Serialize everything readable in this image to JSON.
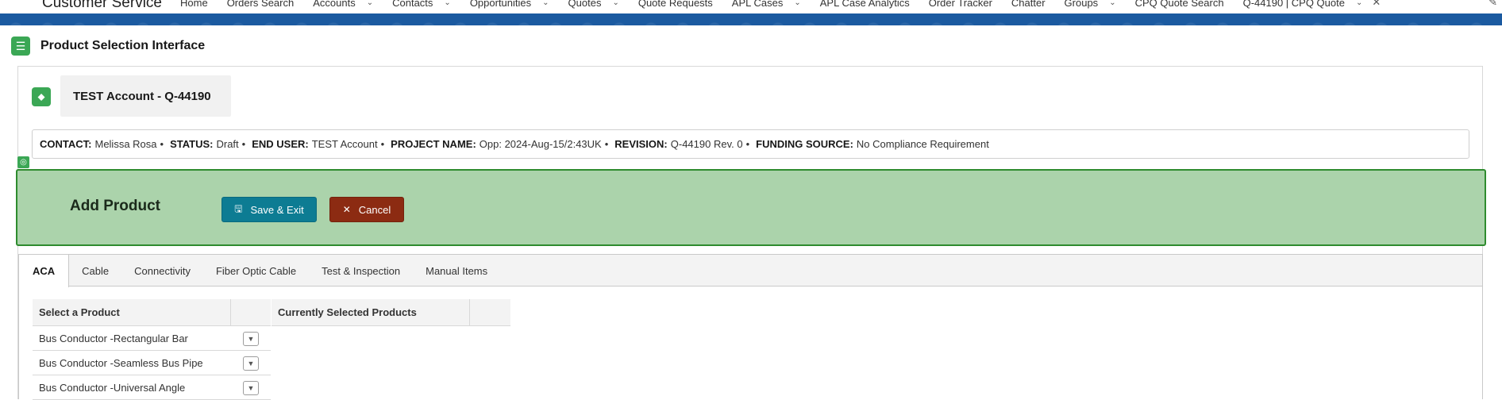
{
  "app": {
    "name": "Customer Service",
    "nav": [
      {
        "label": "Home",
        "chevron": false
      },
      {
        "label": "Orders Search",
        "chevron": false
      },
      {
        "label": "Accounts",
        "chevron": true
      },
      {
        "label": "Contacts",
        "chevron": true
      },
      {
        "label": "Opportunities",
        "chevron": true
      },
      {
        "label": "Quotes",
        "chevron": true
      },
      {
        "label": "Quote Requests",
        "chevron": false
      },
      {
        "label": "APL Cases",
        "chevron": true
      },
      {
        "label": "APL Case Analytics",
        "chevron": false
      },
      {
        "label": "Order Tracker",
        "chevron": false
      },
      {
        "label": "Chatter",
        "chevron": false
      },
      {
        "label": "Groups",
        "chevron": true
      },
      {
        "label": "CPQ Quote Search",
        "chevron": false
      },
      {
        "label": "Q-44190 | CPQ Quote",
        "chevron": true,
        "closable": true
      }
    ],
    "nav_color": "#1b5aa0"
  },
  "page": {
    "title": "Product Selection Interface",
    "record_title": "TEST Account - Q-44190"
  },
  "info": [
    {
      "label": "CONTACT:",
      "value": " Melissa Rosa"
    },
    {
      "label": "STATUS:",
      "value": "Draft"
    },
    {
      "label": "END USER:",
      "value": "TEST Account"
    },
    {
      "label": "PROJECT NAME:",
      "value": "Opp: 2024-Aug-15/2:43UK"
    },
    {
      "label": "REVISION:",
      "value": "Q-44190 Rev. 0"
    },
    {
      "label": "FUNDING SOURCE:",
      "value": "No Compliance Requirement"
    }
  ],
  "add_bar": {
    "title": "Add Product",
    "save_label": "Save & Exit",
    "cancel_label": "Cancel",
    "background": "#abd3ab",
    "save_color": "#0d7c93",
    "cancel_color": "#8c2b12"
  },
  "tabs": [
    {
      "label": "ACA",
      "active": true
    },
    {
      "label": "Cable",
      "active": false
    },
    {
      "label": "Connectivity",
      "active": false
    },
    {
      "label": "Fiber Optic Cable",
      "active": false
    },
    {
      "label": "Test & Inspection",
      "active": false
    },
    {
      "label": "Manual Items",
      "active": false
    }
  ],
  "select_table": {
    "header": "Select a Product",
    "rows": [
      "Bus Conductor -Rectangular Bar",
      "Bus Conductor -Seamless Bus Pipe",
      "Bus Conductor -Universal Angle"
    ]
  },
  "selected_table": {
    "header": "Currently Selected Products"
  },
  "icons": {
    "app_launcher": "app-launcher-icon",
    "page": "product-list-icon",
    "record": "price-tag-icon",
    "dropdown": "chevron-down-icon",
    "save": "save-icon",
    "cancel": "close-icon"
  }
}
